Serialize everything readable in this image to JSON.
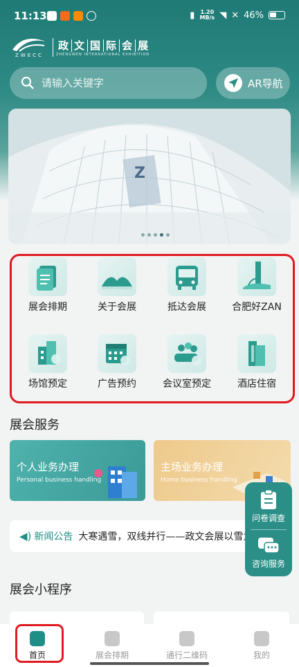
{
  "status": {
    "time": "11:13",
    "speed_value": "1.20",
    "speed_unit": "MB/s",
    "battery": "46%"
  },
  "logo": {
    "mark_text": "ZWECC",
    "name_cn": [
      "政",
      "文",
      "国",
      "际",
      "会",
      "展"
    ],
    "name_en": "ZHENGWEN INTERNATIONAL EXHIBITION"
  },
  "search": {
    "placeholder": "请输入关键字"
  },
  "ar": {
    "label": "AR导航"
  },
  "banner": {
    "slide_count": 5,
    "active_slide": 4
  },
  "quick_grid": [
    {
      "label": "展会排期",
      "icon": "schedule-icon"
    },
    {
      "label": "关于会展",
      "icon": "venue-icon"
    },
    {
      "label": "抵达会展",
      "icon": "bus-icon"
    },
    {
      "label": "合肥好ZAN",
      "icon": "city-icon"
    },
    {
      "label": "场馆预定",
      "icon": "building-icon"
    },
    {
      "label": "广告预约",
      "icon": "calendar-icon"
    },
    {
      "label": "会议室预定",
      "icon": "meeting-icon"
    },
    {
      "label": "酒店住宿",
      "icon": "hotel-icon"
    }
  ],
  "services": {
    "title": "展会服务",
    "personal": {
      "title": "个人业务办理",
      "subtitle": "Personal business handling"
    },
    "host": {
      "title": "主场业务办理",
      "subtitle": "Home business handling"
    }
  },
  "notice": {
    "label": "新闻公告",
    "text": "大寒遇雪，双线并行——政文会展以雪为"
  },
  "float": {
    "survey": "问卷调查",
    "consult": "咨询服务"
  },
  "mini_programs": {
    "title": "展会小程序"
  },
  "tabs": [
    {
      "label": "首页",
      "icon": "home-icon",
      "active": true
    },
    {
      "label": "展会排期",
      "icon": "schedule-icon",
      "active": false
    },
    {
      "label": "通行二维码",
      "icon": "qrcode-icon",
      "active": false
    },
    {
      "label": "我的",
      "icon": "profile-icon",
      "active": false
    }
  ],
  "colors": {
    "primary": "#1f8e86",
    "highlight": "#e0191f"
  }
}
